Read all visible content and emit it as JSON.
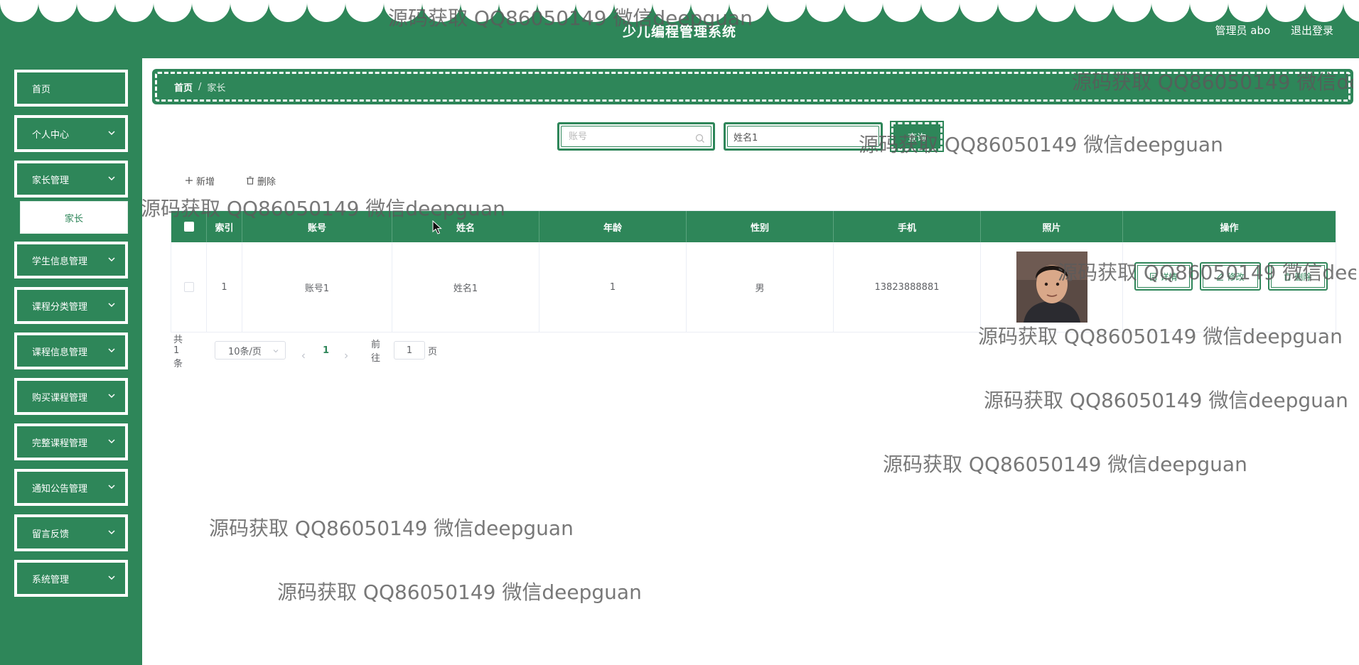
{
  "header": {
    "title": "少儿编程管理系统",
    "user_label": "管理员 abo",
    "logout_label": "退出登录"
  },
  "sidebar": {
    "items": [
      {
        "label": "首页",
        "has_children": false
      },
      {
        "label": "个人中心",
        "has_children": true
      },
      {
        "label": "家长管理",
        "has_children": true
      },
      {
        "label": "学生信息管理",
        "has_children": true
      },
      {
        "label": "课程分类管理",
        "has_children": true
      },
      {
        "label": "课程信息管理",
        "has_children": true
      },
      {
        "label": "购买课程管理",
        "has_children": true
      },
      {
        "label": "完整课程管理",
        "has_children": true
      },
      {
        "label": "通知公告管理",
        "has_children": true
      },
      {
        "label": "留言反馈",
        "has_children": true
      },
      {
        "label": "系统管理",
        "has_children": true
      }
    ],
    "sub_items": [
      {
        "label": "家长"
      }
    ]
  },
  "breadcrumb": {
    "home": "首页",
    "separator": "/",
    "current": "家长"
  },
  "search": {
    "account_placeholder": "账号",
    "name_value": "姓名1",
    "search_label": "查询"
  },
  "actions": {
    "add_label": "新增",
    "delete_label": "删除"
  },
  "table": {
    "columns": [
      "索引",
      "账号",
      "姓名",
      "年龄",
      "性别",
      "手机",
      "照片",
      "操作"
    ],
    "rows": [
      {
        "index": "1",
        "account": "账号1",
        "name": "姓名1",
        "age": "1",
        "gender": "男",
        "phone": "13823888881",
        "ops": [
          "详情",
          "修改",
          "删除"
        ]
      }
    ]
  },
  "pagination": {
    "total": "共 1 条",
    "page_size": "10条/页",
    "current_page": "1",
    "goto_label": "前往",
    "goto_value": "1",
    "page_suffix": "页"
  },
  "watermark": {
    "text": "源码获取 QQ86050149 微信deepguan"
  },
  "colors": {
    "primary": "#2e8659",
    "white": "#ffffff"
  }
}
